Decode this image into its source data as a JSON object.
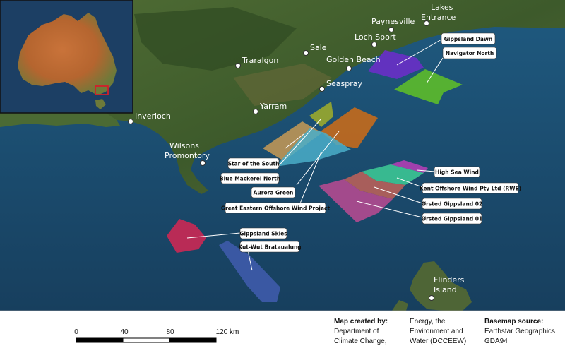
{
  "map": {
    "towns": [
      {
        "name": "Lakes",
        "name2": "Entrance"
      },
      {
        "name": "Paynesville",
        "name2": ""
      },
      {
        "name": "Loch Sport",
        "name2": ""
      },
      {
        "name": "Sale",
        "name2": ""
      },
      {
        "name": "Traralgon",
        "name2": ""
      },
      {
        "name": "Golden Beach",
        "name2": ""
      },
      {
        "name": "Seaspray",
        "name2": ""
      },
      {
        "name": "Yarram",
        "name2": ""
      },
      {
        "name": "Inverloch",
        "name2": ""
      },
      {
        "name": "Wilsons",
        "name2": "Promontory"
      },
      {
        "name": "Flinders",
        "name2": "Island"
      }
    ],
    "projects": [
      {
        "name": "Gippsland Dawn",
        "color": "#6a2fc6"
      },
      {
        "name": "Navigator North",
        "color": "#5dbb2a"
      },
      {
        "name": "Star of the South",
        "color": "#c79a55"
      },
      {
        "name": "Blue Mackerel North",
        "color": "#9aa82e"
      },
      {
        "name": "Aurora Green",
        "color": "#c56a1c"
      },
      {
        "name": "Great Eastern Offshore Wind Project",
        "color": "#4aaec9"
      },
      {
        "name": "High Sea Wind",
        "color": "#b03fb4"
      },
      {
        "name": "Kent Offshore Wind Pty Ltd (RWE)",
        "color": "#3cc593"
      },
      {
        "name": "Ørsted Gippsland 02",
        "color": "#b8605a"
      },
      {
        "name": "Ørsted Gippsland 01",
        "color": "#b24a90"
      },
      {
        "name": "Gippsland Skies",
        "color": "#c22a55"
      },
      {
        "name": "Kut-Wut Brataualung",
        "color": "#3c5aa6"
      }
    ],
    "colors": {
      "sea": "#1c4f73",
      "land": "#3f5a2e",
      "inset_box": "#d1202a"
    }
  },
  "footer": {
    "scale_ticks": [
      "0",
      "40",
      "80",
      "120 km"
    ],
    "credit_title": "Map created by:",
    "credit_line1": "Department of",
    "credit_line2": "Climate Change,",
    "credit_line3": "Energy, the",
    "credit_line4": "Environment and",
    "credit_line5": "Water (DCCEEW)",
    "basemap_title": "Basemap source:",
    "basemap_line1": "Earthstar Geographics",
    "basemap_line2": "GDA94"
  }
}
